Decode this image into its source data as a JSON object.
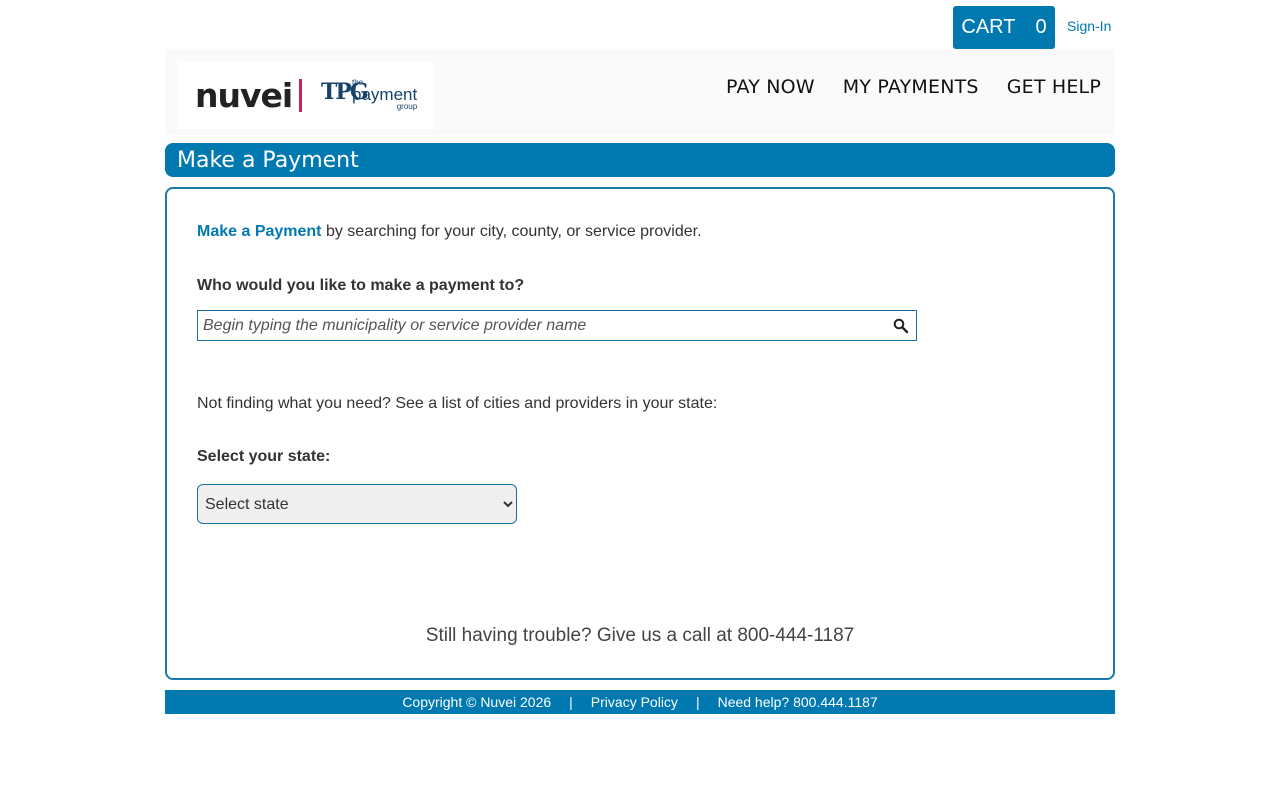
{
  "topbar": {
    "cart_label": "CART",
    "cart_count": "0",
    "sign_in": "Sign-In"
  },
  "logo": {
    "brand": "nuvei",
    "partner_mark": "TPG",
    "partner_line1": "the",
    "partner_line2": "payment",
    "partner_line3": "group"
  },
  "nav": {
    "items": [
      "PAY NOW",
      "MY PAYMENTS",
      "GET HELP"
    ]
  },
  "page": {
    "title": "Make a Payment"
  },
  "main": {
    "intro_link": "Make a Payment",
    "intro_rest": " by searching for your city, county, or service provider.",
    "who_label": "Who would you like to make a payment to?",
    "search_placeholder": "Begin typing the municipality or service provider name",
    "not_finding": "Not finding what you need? See a list of cities and providers in your state:",
    "state_label": "Select your state:",
    "state_selected": "Select state",
    "trouble": "Still having trouble? Give us a call at 800-444-1187"
  },
  "footer": {
    "copyright": "Copyright © Nuvei 2026",
    "separator": "|",
    "privacy": "Privacy Policy",
    "help": "Need help? 800.444.1187"
  },
  "colors": {
    "brand_blue": "#0079b1",
    "logo_accent": "#c8205f",
    "logo_navy": "#16436a"
  },
  "icons": {
    "search": "search-icon"
  }
}
